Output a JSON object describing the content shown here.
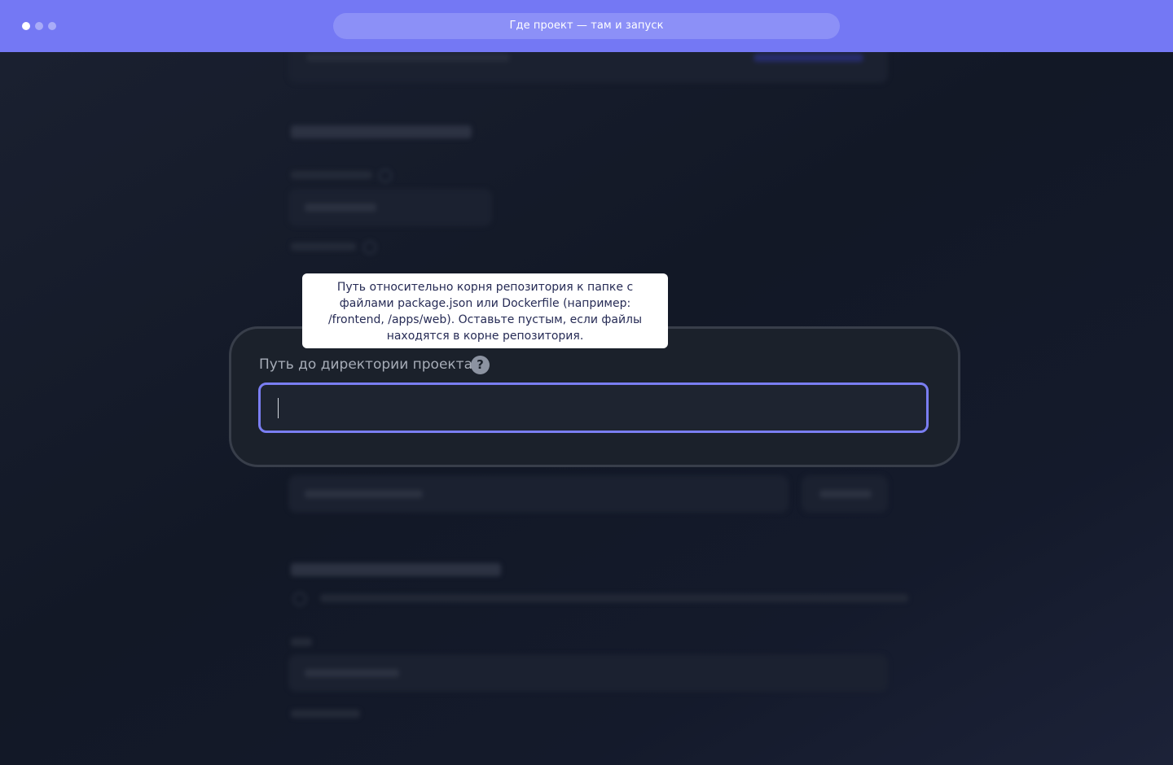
{
  "window": {
    "title": "Где проект — там и запуск"
  },
  "colors": {
    "accent": "#7478f4",
    "field_border": "#7a7ef2",
    "tooltip_text": "#262b55",
    "card_bg": "#1b212b"
  },
  "field": {
    "label": "Путь до директории проекта",
    "value": "",
    "help_icon": "question-icon"
  },
  "tooltip": {
    "text": "Путь относительно корня репозитория к папке с файлами package.json или Dockerfile (например: /frontend, /apps/web). Оставьте пустым, если файлы находятся в корне репозитория."
  }
}
